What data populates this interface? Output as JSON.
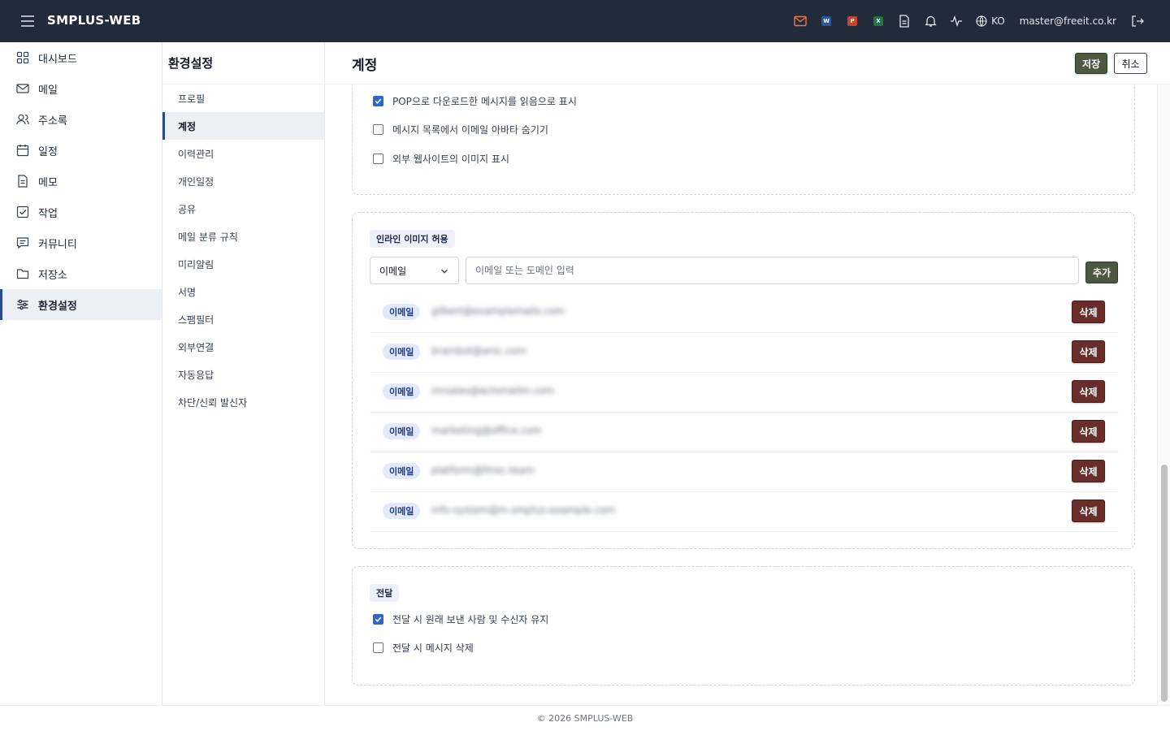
{
  "app": {
    "brand": "SMPLUS-WEB",
    "language": "KO",
    "user_email": "master@freeit.co.kr",
    "footer": "© 2026 SMPLUS-WEB"
  },
  "topbar": {
    "icons": [
      "mail-icon",
      "word-icon",
      "powerpoint-icon",
      "excel-icon",
      "document-icon",
      "bell-icon",
      "activity-icon",
      "globe-icon",
      "logout-icon"
    ],
    "word_letter": "W",
    "ppt_letter": "P",
    "excel_letter": "X",
    "colors": {
      "bg": "#222b3a",
      "mail": "#e8774a",
      "word": "#2b579a",
      "ppt": "#c4452a",
      "excel": "#217346"
    }
  },
  "leftnav": {
    "items": [
      {
        "label": "대시보드",
        "icon": "dashboard-icon"
      },
      {
        "label": "메일",
        "icon": "mail-icon"
      },
      {
        "label": "주소록",
        "icon": "contacts-icon"
      },
      {
        "label": "일정",
        "icon": "calendar-icon"
      },
      {
        "label": "메모",
        "icon": "memo-icon"
      },
      {
        "label": "작업",
        "icon": "task-icon"
      },
      {
        "label": "커뮤니티",
        "icon": "community-icon"
      },
      {
        "label": "저장소",
        "icon": "folder-icon"
      },
      {
        "label": "환경설정",
        "icon": "settings-sliders-icon",
        "active": true
      }
    ]
  },
  "subnav": {
    "title": "환경설정",
    "items": [
      {
        "label": "프로필"
      },
      {
        "label": "계정",
        "active": true
      },
      {
        "label": "이력관리"
      },
      {
        "label": "개인일정"
      },
      {
        "label": "공유"
      },
      {
        "label": "메일 분류 규칙"
      },
      {
        "label": "미리알림"
      },
      {
        "label": "서명"
      },
      {
        "label": "스팸필터"
      },
      {
        "label": "외부연결"
      },
      {
        "label": "자동응답"
      },
      {
        "label": "차단/신뢰 발신자"
      }
    ]
  },
  "header": {
    "title": "계정",
    "save_label": "저장",
    "cancel_label": "취소"
  },
  "display_section": {
    "options": [
      {
        "label": "POP으로 다운로드한 메시지를 읽음으로 표시",
        "checked": true
      },
      {
        "label": "메시지 목록에서 이메일 아바타 숨기기",
        "checked": false
      },
      {
        "label": "외부 웹사이트의 이미지 표시",
        "checked": false
      }
    ]
  },
  "inline_images": {
    "tag": "인라인 이미지 허용",
    "select_value": "이메일",
    "input_placeholder": "이메일 또는 도메인 입력",
    "add_label": "추가",
    "delete_label": "삭제",
    "entries": [
      {
        "type": "이메일",
        "value": "gilbert@examplemails.com"
      },
      {
        "type": "이메일",
        "value": "brainbot@anic.com"
      },
      {
        "type": "이메일",
        "value": "mrsales@actsmailm.com"
      },
      {
        "type": "이메일",
        "value": "marketing@office.com"
      },
      {
        "type": "이메일",
        "value": "platform@fmsc.team"
      },
      {
        "type": "이메일",
        "value": "info-system@m.smplus-example.com"
      }
    ]
  },
  "forwarding": {
    "tag": "전달",
    "options": [
      {
        "label": "전달 시 원래 보낸 사람 및 수신자 유지",
        "checked": true
      },
      {
        "label": "전달 시 메시지 삭제",
        "checked": false
      }
    ]
  }
}
